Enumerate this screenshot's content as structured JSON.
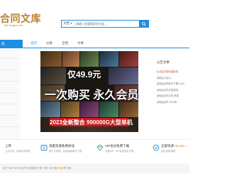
{
  "header": {
    "logo_cn": "合同文库",
    "logo_en": "Bai Tongzhu Life"
  },
  "search": {
    "scope": "文档",
    "placeholder": "请输入您要搜索的内容..."
  },
  "nav": {
    "left_label": "类",
    "items": [
      {
        "label": "首页",
        "active": true
      },
      {
        "label": "分类",
        "active": false
      },
      {
        "label": "全档",
        "active": false
      },
      {
        "label": "文章",
        "active": false
      }
    ]
  },
  "banner": {
    "price_text": "仅49.9元",
    "headline": "一次购买 永久会员",
    "subline": "2023全新整合 990000G大型单机"
  },
  "announcements": {
    "title": "公告文章",
    "items": [
      {
        "text": "[公告]文档内容投诉...",
        "highlight": true
      },
      {
        "text": "[网站]公告10",
        "highlight": false
      },
      {
        "text": "[网站]合同范本下载3 160",
        "highlight": false
      },
      {
        "text": "[网站]合同文档说明",
        "highlight": false
      },
      {
        "text": "[网站]合同文档 资源",
        "highlight": false
      },
      {
        "text": "[网站]合同 2023年",
        "highlight": false
      }
    ]
  },
  "features": [
    {
      "title": "上传",
      "desc": "上传文档...资源共享有奖",
      "icon": "upload-icon",
      "color": "#1e8ee0"
    },
    {
      "title": "海量资源免费阅读",
      "desc": "数十万资源，免费阅读即时下载",
      "icon": "reading-icon",
      "color": "#1e8ee0"
    },
    {
      "title": "VIP会员免费下载",
      "desc": "开通VIP，VIP会员免费下载",
      "icon": "vip-diamond-icon",
      "color": "#3aa876"
    },
    {
      "title": "全部资源 ",
      "highlight": "00,642 +",
      "desc": "会员资源 随时",
      "icon": "resources-icon",
      "color": "#1e8ee0"
    }
  ],
  "breadcrumb": {
    "prefix": "用户\"ABFT88\"发出的\"用例模板下载\" 资料 请下载",
    "suffix": " 领取",
    "link": "8+6全界"
  }
}
